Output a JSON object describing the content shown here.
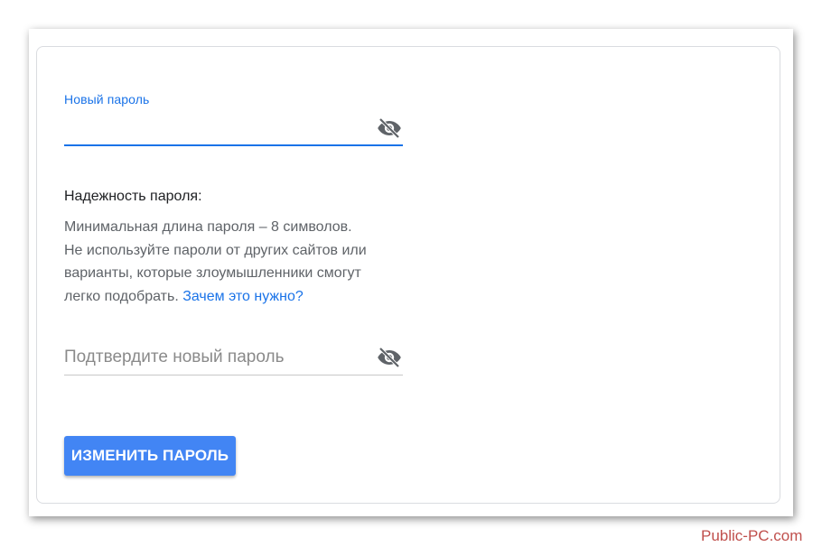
{
  "form": {
    "new_password_label": "Новый пароль",
    "new_password_value": "",
    "new_password_placeholder": "",
    "strength_title": "Надежность пароля:",
    "strength_lines": [
      "Минимальная длина пароля – 8 символов.",
      "Не используйте пароли от других сайтов или",
      "варианты, которые злоумышленники смогут",
      "легко подобрать. "
    ],
    "help_link": "Зачем это нужно?",
    "confirm_password_placeholder": "Подтвердите новый пароль",
    "submit_label": "ИЗМЕНИТЬ ПАРОЛЬ"
  },
  "icons": {
    "visibility_toggle": "visibility-off-icon"
  },
  "colors": {
    "accent": "#1a73e8",
    "button": "#4285f4",
    "watermark": "#c0504d"
  },
  "watermark": "Public-PC.com"
}
